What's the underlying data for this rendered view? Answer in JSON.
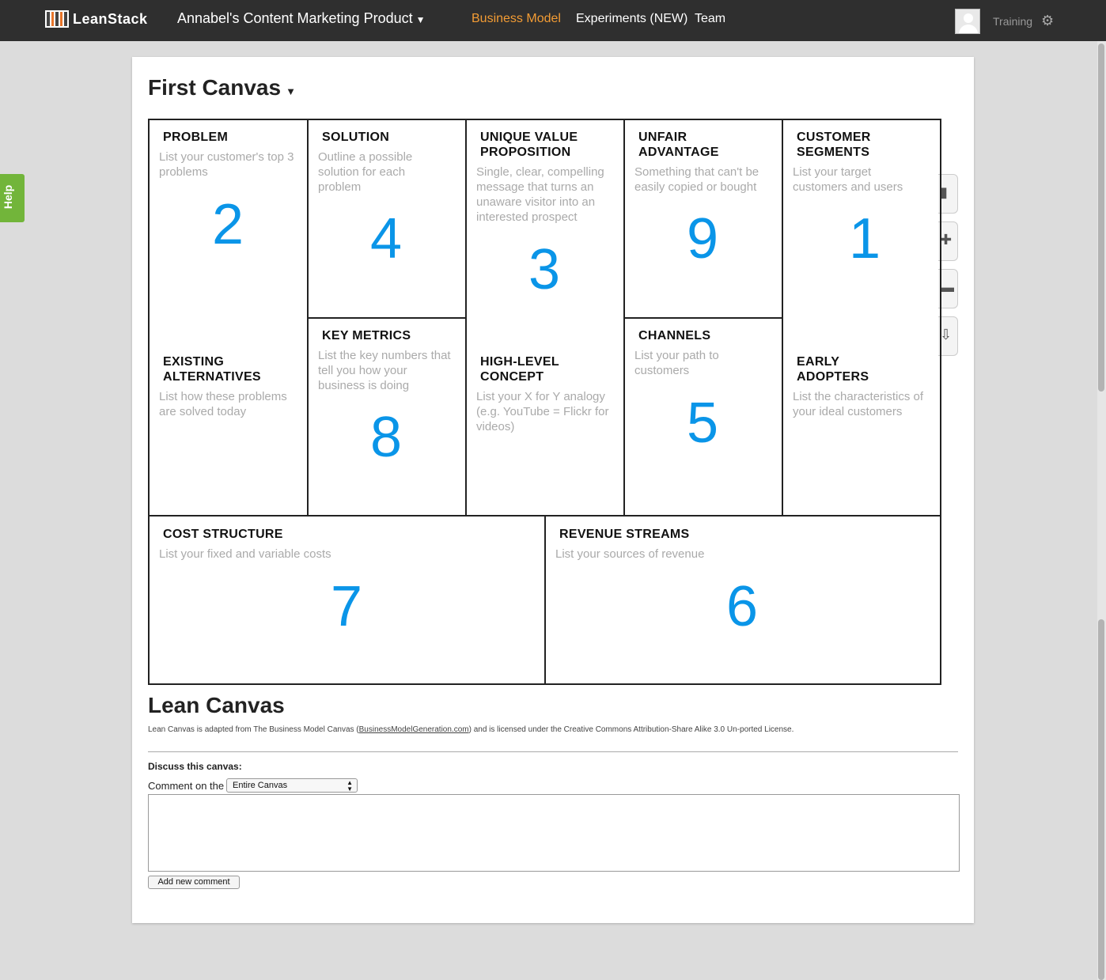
{
  "header": {
    "logo_text": "LeanStack",
    "product": "Annabel's Content Marketing Product",
    "nav": {
      "business_model": "Business Model",
      "experiments": "Experiments (NEW)",
      "team": "Team"
    },
    "user_label": "Training",
    "accent_color": "#f39c34"
  },
  "help_label": "Help",
  "canvas": {
    "title": "First Canvas",
    "number_color": "#0a95e8",
    "boxes": {
      "problem": {
        "title": "PROBLEM",
        "desc": "List your customer's top 3 problems",
        "number": "2"
      },
      "existing": {
        "title_1": "EXISTING",
        "title_2": "ALTERNATIVES",
        "desc_1": "List how these problems",
        "desc_2": "are solved today"
      },
      "solution": {
        "title": "SOLUTION",
        "desc_1": "Outline a possible",
        "desc_2": "solution for each",
        "desc_3": "problem",
        "number": "4"
      },
      "key_metrics": {
        "title": "KEY METRICS",
        "desc_1": "List the key numbers that",
        "desc_2": "tell you how your",
        "desc_3": "business is doing",
        "number": "8"
      },
      "uvp": {
        "title_1": "UNIQUE VALUE",
        "title_2": "PROPOSITION",
        "desc_1": "Single, clear, compelling",
        "desc_2": "message that turns an",
        "desc_3": "unaware visitor into an",
        "desc_4": "interested prospect",
        "number": "3"
      },
      "high_level": {
        "title_1": "HIGH-LEVEL",
        "title_2": "CONCEPT",
        "desc_1": "List your X for Y analogy",
        "desc_2": "(e.g. YouTube = Flickr for",
        "desc_3": "videos)"
      },
      "unfair": {
        "title_1": "UNFAIR",
        "title_2": "ADVANTAGE",
        "desc_1": "Something that can't be",
        "desc_2": "easily copied or bought",
        "number": "9"
      },
      "channels": {
        "title": "CHANNELS",
        "desc_1": "List your path to",
        "desc_2": "customers",
        "number": "5"
      },
      "segments": {
        "title_1": "CUSTOMER",
        "title_2": "SEGMENTS",
        "desc_1": "List your target",
        "desc_2": "customers and users",
        "number": "1"
      },
      "early": {
        "title_1": "EARLY",
        "title_2": "ADOPTERS",
        "desc_1": "List the characteristics of",
        "desc_2": "your ideal customers"
      },
      "cost": {
        "title": "COST STRUCTURE",
        "desc": "List your fixed and variable costs",
        "number": "7"
      },
      "revenue": {
        "title": "REVENUE STREAMS",
        "desc": "List your sources of revenue",
        "number": "6"
      }
    }
  },
  "footer": {
    "title": "Lean Canvas",
    "license_pre": "Lean Canvas is adapted from The Business Model Canvas (",
    "license_link": "BusinessModelGeneration.com",
    "license_post": ") and is licensed under the Creative Commons Attribution-Share Alike 3.0 Un-ported License.",
    "discuss_label": "Discuss this canvas:",
    "comment_on_label": "Comment on the",
    "comment_target": "Entire Canvas",
    "add_button": "Add new comment"
  }
}
